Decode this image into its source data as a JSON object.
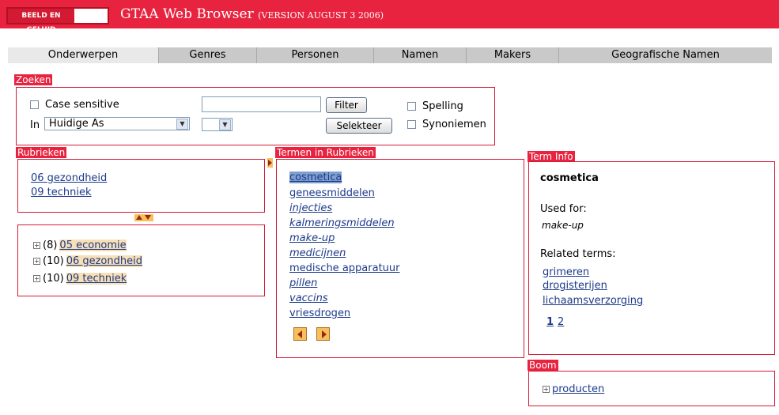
{
  "header": {
    "logo_text": "BEELD EN GELUID",
    "title": "GTAA Web Browser",
    "version": "(VERSION AUGUST 3 2006)",
    "brand_color": "#e8233f"
  },
  "tabs": [
    {
      "label": "Onderwerpen",
      "active": true
    },
    {
      "label": "Genres"
    },
    {
      "label": "Personen"
    },
    {
      "label": "Namen"
    },
    {
      "label": "Makers"
    },
    {
      "label": "Geografische Namen"
    }
  ],
  "search": {
    "section_label": "Zoeken",
    "case_sensitive_label": "Case sensitive",
    "in_label": "In",
    "in_value": "Huidige As",
    "second_select_value": "",
    "filter_value": "",
    "filter_button": "Filter",
    "select_button": "Selekteer",
    "spelling_label": "Spelling",
    "synonyms_label": "Synoniemen"
  },
  "rubrieken": {
    "section_label": "Rubrieken",
    "selected": [
      "06 gezondheid",
      "09 techniek"
    ],
    "tree": [
      {
        "count": "(8)",
        "label": "05 economie"
      },
      {
        "count": "(10)",
        "label": "06 gezondheid"
      },
      {
        "count": "(10)",
        "label": "09 techniek"
      }
    ]
  },
  "termen": {
    "section_label": "Termen in Rubrieken",
    "items": [
      {
        "label": "cosmetica",
        "selected": true
      },
      {
        "label": "geneesmiddelen"
      },
      {
        "label": "injecties",
        "italic": true
      },
      {
        "label": "kalmeringsmiddelen",
        "italic": true
      },
      {
        "label": "make-up",
        "italic": true
      },
      {
        "label": "medicijnen",
        "italic": true
      },
      {
        "label": "medische apparatuur"
      },
      {
        "label": "pillen",
        "italic": true
      },
      {
        "label": "vaccins",
        "italic": true
      },
      {
        "label": "vriesdrogen"
      }
    ]
  },
  "term_info": {
    "section_label": "Term Info",
    "term": "cosmetica",
    "used_for_label": "Used for:",
    "used_for": "make-up",
    "related_label": "Related terms:",
    "related": [
      "grimeren",
      "drogisterijen",
      "lichaamsverzorging"
    ],
    "pages": [
      "1",
      "2"
    ]
  },
  "boom": {
    "section_label": "Boom",
    "items": [
      "producten"
    ]
  },
  "icons": {
    "expand": "plus-box-icon",
    "prev": "arrow-left-icon",
    "next": "arrow-right-icon",
    "dropdown": "chevron-down-icon",
    "toggle": "up-down-arrows-icon"
  }
}
